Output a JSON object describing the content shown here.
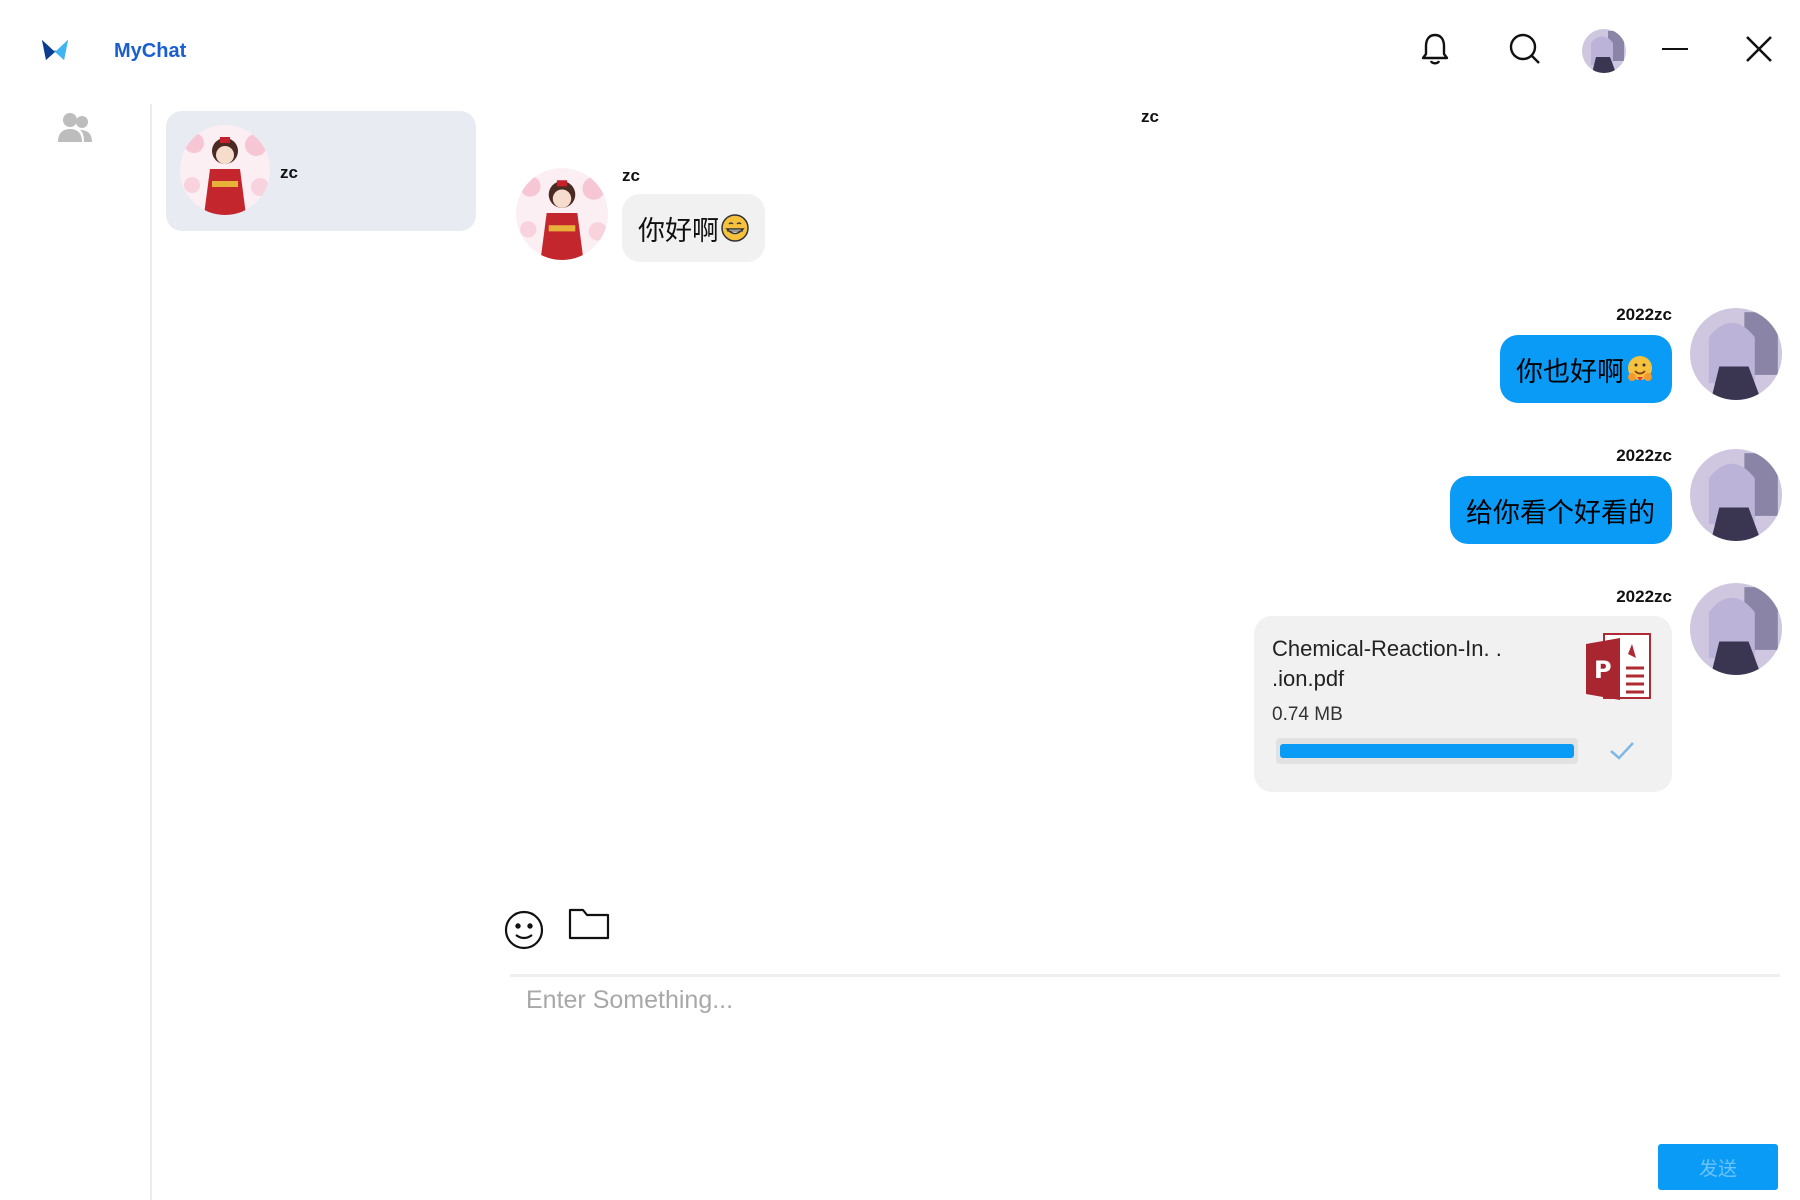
{
  "app": {
    "title": "MyChat",
    "logo_icon": "mychat-logo-icon"
  },
  "titlebar": {
    "icons": [
      "bell-icon",
      "search-icon",
      "user-avatar",
      "minimize-icon",
      "close-icon"
    ]
  },
  "sidebar": {
    "contacts_icon": "contacts-icon"
  },
  "contacts": [
    {
      "name": "zc",
      "avatar": "red-kimono-girl-avatar",
      "selected": true
    }
  ],
  "chat": {
    "title": "zc",
    "messages": [
      {
        "sender": "zc",
        "direction": "in",
        "text": "你好啊",
        "emoji": "grinning-emoji"
      },
      {
        "sender": "2022zc",
        "direction": "out",
        "text": "你也好啊",
        "emoji": "hugging-emoji"
      },
      {
        "sender": "2022zc",
        "direction": "out",
        "text": "给你看个好看的"
      },
      {
        "sender": "2022zc",
        "direction": "out",
        "type": "file",
        "file": {
          "name": "Chemical-Reaction-In. .\n.ion.pdf",
          "size": "0.74 MB",
          "progress": 1.0,
          "status": "sent"
        }
      }
    ]
  },
  "composer": {
    "placeholder": "Enter Something...",
    "value": "",
    "send_label": "发送",
    "tools": [
      "emoji-icon",
      "folder-icon"
    ]
  },
  "colors": {
    "accent": "#0a9bf7",
    "brand": "#1a5fd1",
    "bubble_in": "#f1f1f1",
    "contact_selected": "#e8ebf2"
  }
}
